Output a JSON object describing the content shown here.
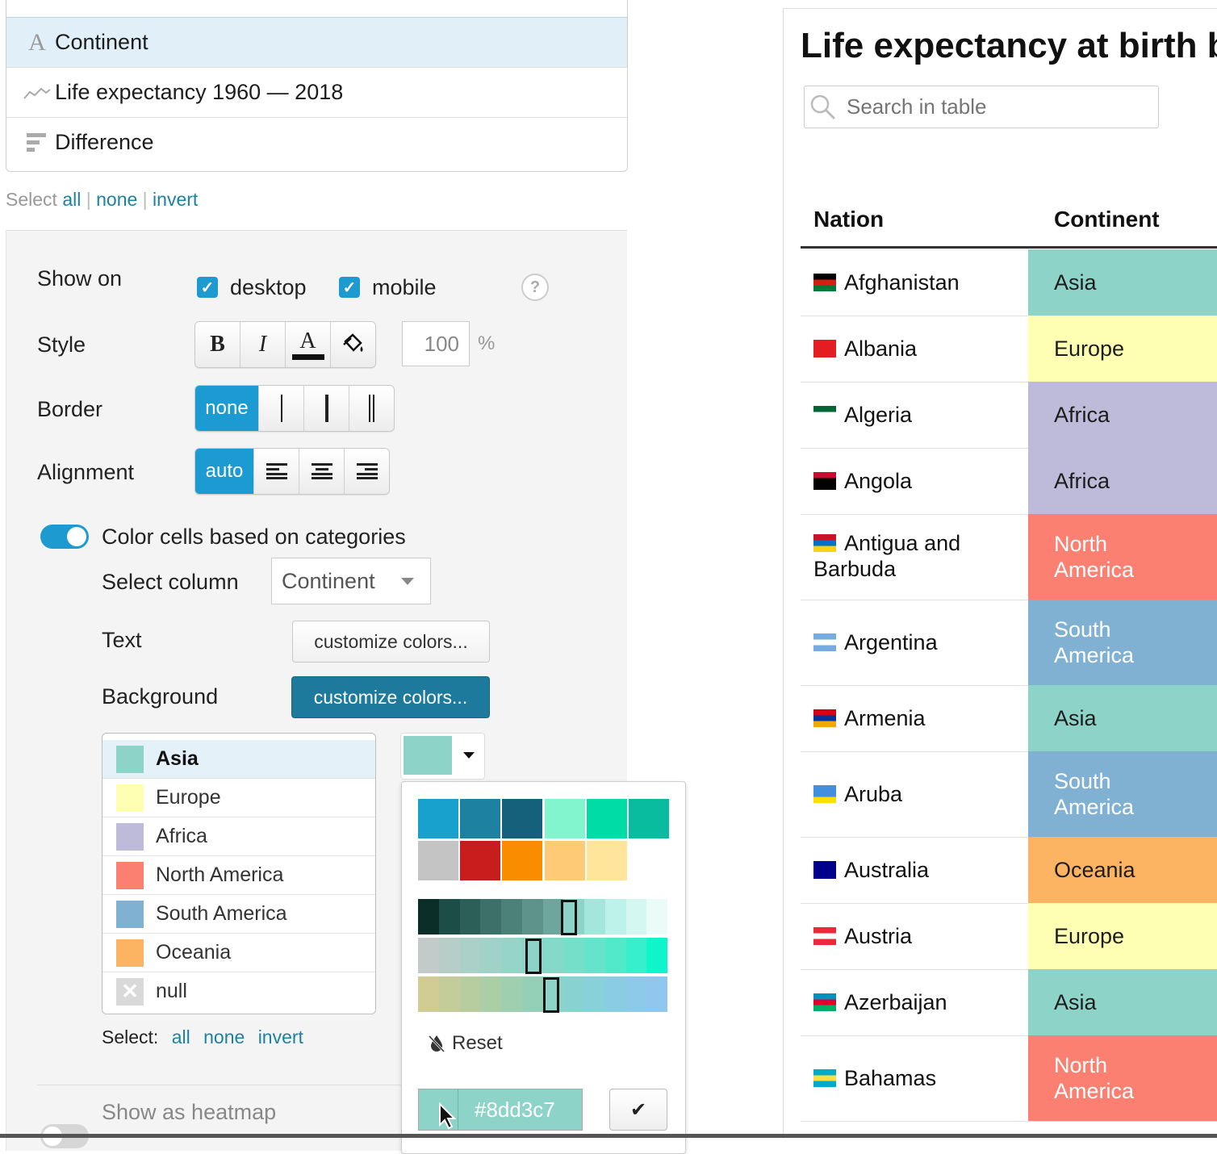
{
  "columns_list": {
    "items": [
      {
        "label": "Continent",
        "icon": "text-icon",
        "selected": true
      },
      {
        "label": "Life expectancy 1960 — 2018",
        "icon": "sparkline-icon"
      },
      {
        "label": "Difference",
        "icon": "bar-icon"
      }
    ],
    "select_prefix": "Select",
    "select_all": "all",
    "select_none": "none",
    "select_invert": "invert"
  },
  "settings": {
    "show_on_label": "Show on",
    "desktop_label": "desktop",
    "mobile_label": "mobile",
    "help_glyph": "?",
    "style_label": "Style",
    "bold_glyph": "B",
    "italic_glyph": "I",
    "textcolor_glyph": "A",
    "width_value": "100",
    "width_unit": "%",
    "border_label": "Border",
    "border_none": "none",
    "alignment_label": "Alignment",
    "alignment_auto": "auto",
    "color_cells_label": "Color cells based on categories",
    "color_cells_on": true,
    "select_column_label": "Select column",
    "select_column_value": "Continent",
    "text_label": "Text",
    "text_button": "customize colors...",
    "background_label": "Background",
    "background_button": "customize colors...",
    "categories": [
      {
        "name": "Asia",
        "color": "#8dd3c7"
      },
      {
        "name": "Europe",
        "color": "#ffffb3"
      },
      {
        "name": "Africa",
        "color": "#bebada"
      },
      {
        "name": "North America",
        "color": "#fb8072"
      },
      {
        "name": "South America",
        "color": "#80b1d3"
      },
      {
        "name": "Oceania",
        "color": "#fdb462"
      },
      {
        "name": "null",
        "color": "#d9d9d9"
      }
    ],
    "cat_select_prefix": "Select:",
    "cat_select_all": "all",
    "cat_select_none": "none",
    "cat_select_invert": "invert",
    "heatmap_label": "Show as heatmap",
    "heatmap_on": false
  },
  "color_picker": {
    "current_color": "#8dd3c7",
    "palette": [
      "#18a1cd",
      "#1d81a2",
      "#15607a",
      "#82f5cf",
      "#00dca6",
      "#09bb9f",
      "#c4c4c4",
      "#c71e1d",
      "#fa8c00",
      "#ffca76",
      "#ffe59c"
    ],
    "gradient_dark": [
      "#0b2e28",
      "#1c4d46",
      "#2b5f57",
      "#3c7068",
      "#4c8179",
      "#5d938a",
      "#6ea59c",
      "#8dd3c7",
      "#a4e6db",
      "#bcf2e9",
      "#d4f7f1",
      "#ebfbf8"
    ],
    "gradient_sat": [
      "#c2cbc9",
      "#b6cdc8",
      "#abd0c8",
      "#a0d2c8",
      "#96d4c7",
      "#8dd3c7",
      "#84d9c9",
      "#75dfca",
      "#66e4cb",
      "#52e9cb",
      "#38efcb",
      "#0ff5cb"
    ],
    "gradient_hue": [
      "#d1cc94",
      "#c4cc99",
      "#b7cd9f",
      "#aacea6",
      "#9ecfae",
      "#94d0b8",
      "#8dd3c7",
      "#88d2d2",
      "#88d0da",
      "#8acde3",
      "#8dcaea",
      "#90c7ef"
    ],
    "reset_label": "Reset",
    "hex_value": "#8dd3c7",
    "confirm_glyph": "✔"
  },
  "table": {
    "title": "Life expectancy at birth by",
    "search_placeholder": "Search in table",
    "col_nation": "Nation",
    "col_continent": "Continent",
    "rows": [
      {
        "nation": "Afghanistan",
        "continent": "Asia",
        "bg": "#8dd3c7",
        "fg": "#1d1d1d"
      },
      {
        "nation": "Albania",
        "continent": "Europe",
        "bg": "#ffffb3",
        "fg": "#1d1d1d"
      },
      {
        "nation": "Algeria",
        "continent": "Africa",
        "bg": "#bebada",
        "fg": "#1d1d1d"
      },
      {
        "nation": "Angola",
        "continent": "Africa",
        "bg": "#bebada",
        "fg": "#1d1d1d"
      },
      {
        "nation": "Antigua and Barbuda",
        "continent": "North America",
        "bg": "#fb8072",
        "fg": "#ffffff"
      },
      {
        "nation": "Argentina",
        "continent": "South America",
        "bg": "#80b1d3",
        "fg": "#ffffff"
      },
      {
        "nation": "Armenia",
        "continent": "Asia",
        "bg": "#8dd3c7",
        "fg": "#1d1d1d"
      },
      {
        "nation": "Aruba",
        "continent": "South America",
        "bg": "#80b1d3",
        "fg": "#ffffff"
      },
      {
        "nation": "Australia",
        "continent": "Oceania",
        "bg": "#fdb462",
        "fg": "#1d1d1d"
      },
      {
        "nation": "Austria",
        "continent": "Europe",
        "bg": "#ffffb3",
        "fg": "#1d1d1d"
      },
      {
        "nation": "Azerbaijan",
        "continent": "Asia",
        "bg": "#8dd3c7",
        "fg": "#1d1d1d"
      },
      {
        "nation": "Bahamas",
        "continent": "North America",
        "bg": "#fb8072",
        "fg": "#ffffff"
      }
    ]
  }
}
